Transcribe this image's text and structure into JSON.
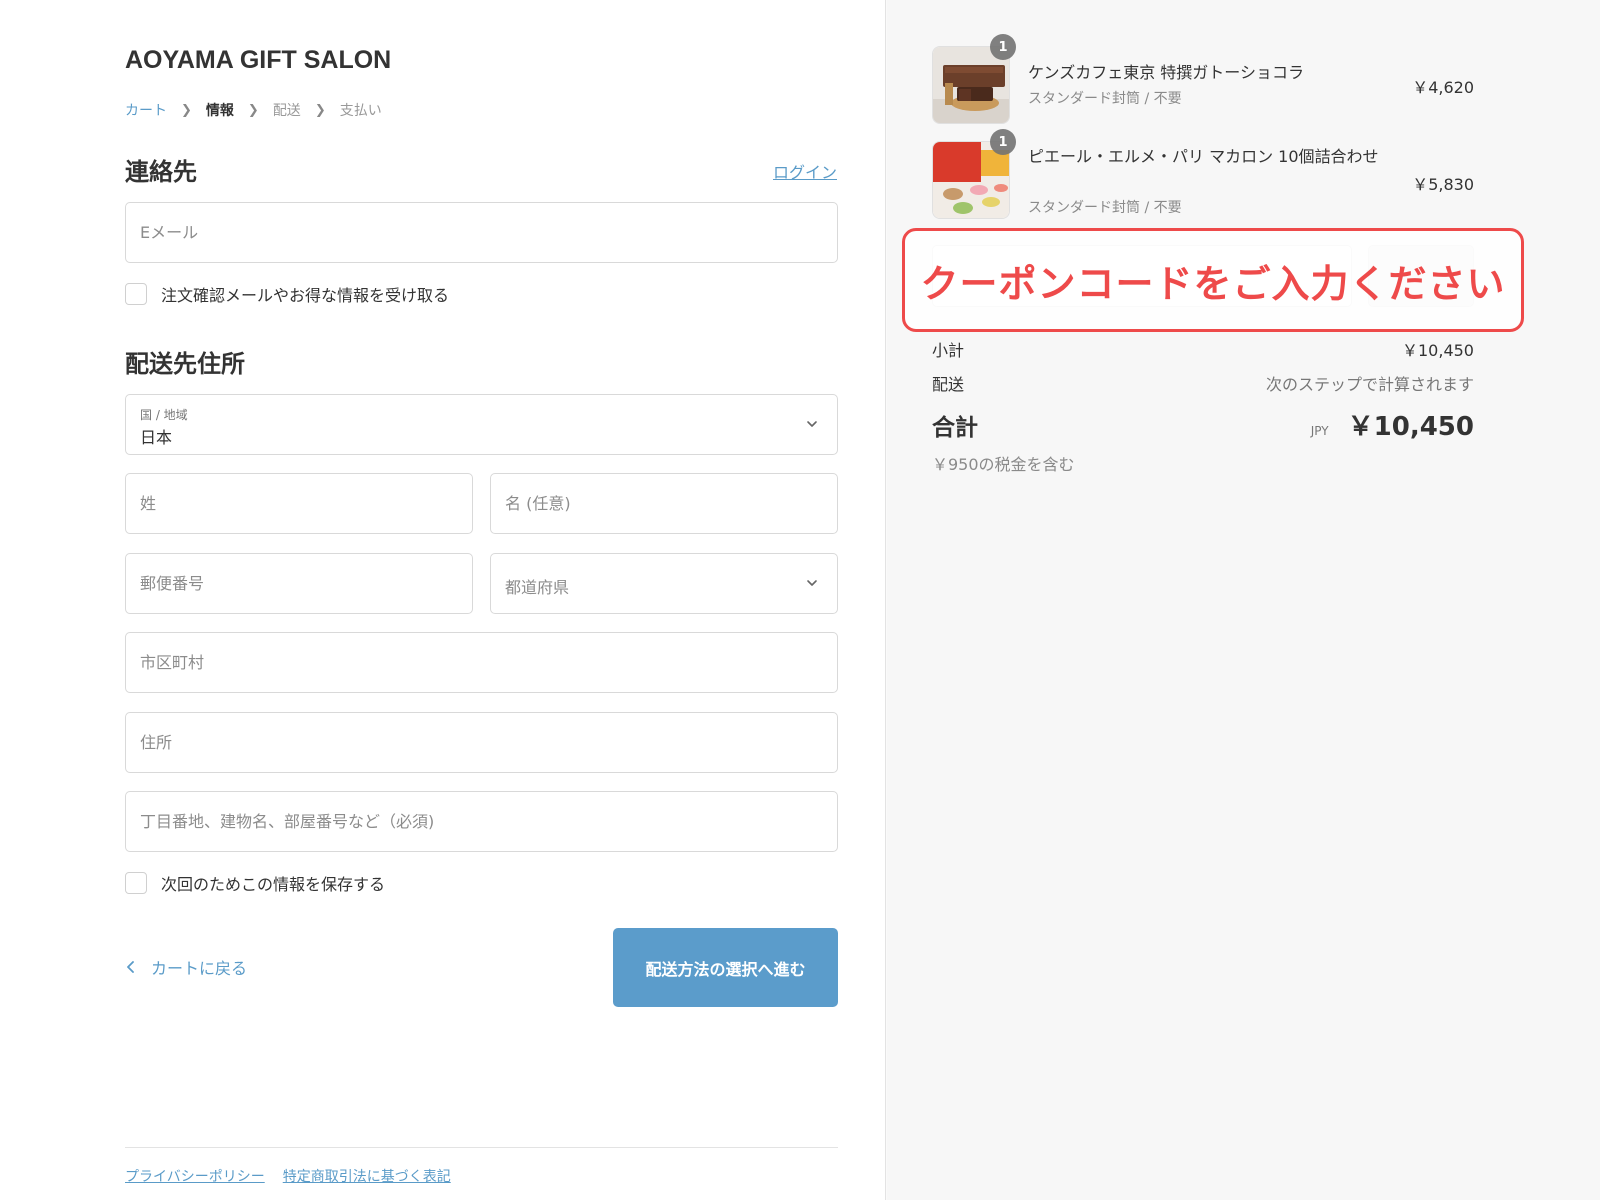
{
  "store": {
    "name": "AOYAMA GIFT SALON"
  },
  "breadcrumb": [
    {
      "label": "カート"
    },
    {
      "label": "情報"
    },
    {
      "label": "配送"
    },
    {
      "label": "支払い"
    }
  ],
  "contact": {
    "title": "連絡先",
    "login_label": "ログイン",
    "email_placeholder": "Eメール",
    "newsletter_label": "注文確認メールやお得な情報を受け取る"
  },
  "shipping": {
    "title": "配送先住所",
    "country_label": "国 / 地域",
    "country_value": "日本",
    "last_name_placeholder": "姓",
    "first_name_placeholder": "名 (任意)",
    "postal_placeholder": "郵便番号",
    "prefecture_placeholder": "都道府県",
    "city_placeholder": "市区町村",
    "address_placeholder": "住所",
    "address2_placeholder": "丁目番地、建物名、部屋番号など（必須)",
    "save_info_label": "次回のためこの情報を保存する"
  },
  "actions": {
    "back_label": "カートに戻る",
    "continue_label": "配送方法の選択へ進む"
  },
  "footer": {
    "privacy_label": "プライバシーポリシー",
    "legal_label": "特定商取引法に基づく表記"
  },
  "cart": {
    "items": [
      {
        "name": "ケンズカフェ東京 特撰ガトーショコラ",
        "variant": "スタンダード封筒 / 不要",
        "price": "￥4,620",
        "quantity": "1"
      },
      {
        "name": "ピエール・エルメ・パリ マカロン 10個詰合わせ",
        "variant": "スタンダード封筒 / 不要",
        "price": "￥5,830",
        "quantity": "1"
      }
    ],
    "coupon_annotation": "クーポンコードをご入力ください",
    "subtotal_label": "小計",
    "subtotal_value": "￥10,450",
    "shipping_label": "配送",
    "shipping_value": "次のステップで計算されます",
    "total_label": "合計",
    "total_currency": "JPY",
    "total_value": "￥10,450",
    "tax_note": "￥950の税金を含む"
  },
  "colors": {
    "accent": "#5b9ccb",
    "annotation": "#ee4a4a"
  }
}
